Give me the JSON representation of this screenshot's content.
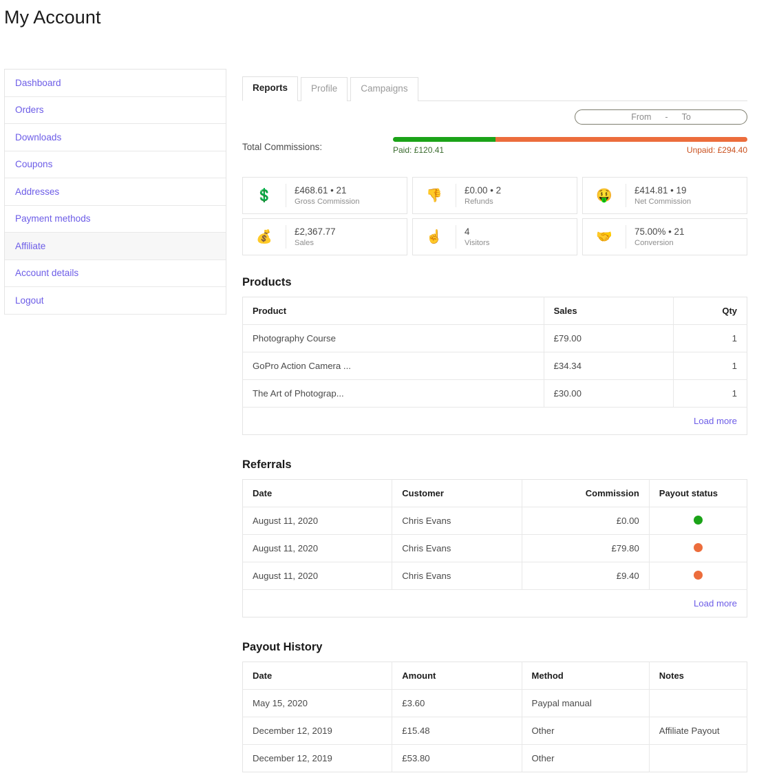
{
  "page": {
    "title": "My Account"
  },
  "sidebar": {
    "items": [
      {
        "label": "Dashboard",
        "active": false
      },
      {
        "label": "Orders",
        "active": false
      },
      {
        "label": "Downloads",
        "active": false
      },
      {
        "label": "Coupons",
        "active": false
      },
      {
        "label": "Addresses",
        "active": false
      },
      {
        "label": "Payment methods",
        "active": false
      },
      {
        "label": "Affiliate",
        "active": true
      },
      {
        "label": "Account details",
        "active": false
      },
      {
        "label": "Logout",
        "active": false
      }
    ]
  },
  "tabs": [
    {
      "label": "Reports",
      "active": true
    },
    {
      "label": "Profile",
      "active": false
    },
    {
      "label": "Campaigns",
      "active": false
    }
  ],
  "date_filter": {
    "from_placeholder": "From",
    "separator": "-",
    "to_placeholder": "To"
  },
  "commissions": {
    "label": "Total Commissions:",
    "paid_legend": "Paid: £120.41",
    "unpaid_legend": "Unpaid: £294.40",
    "paid_amount": 120.41,
    "unpaid_amount": 294.4,
    "paid_percent": 29,
    "paid_color": "#1ba318",
    "unpaid_color": "#ec6d3c"
  },
  "stats": [
    {
      "icon": "dollar-sign-icon",
      "glyph": "💲",
      "value": "£468.61 • 21",
      "label": "Gross Commission"
    },
    {
      "icon": "thumbs-down-icon",
      "glyph": "👎",
      "value": "£0.00 • 2",
      "label": "Refunds"
    },
    {
      "icon": "money-with-wings-icon",
      "glyph": "🤑",
      "value": "£414.81 • 19",
      "label": "Net Commission"
    },
    {
      "icon": "coins-icon",
      "glyph": "💰",
      "value": "£2,367.77",
      "label": "Sales"
    },
    {
      "icon": "pointing-finger-icon",
      "glyph": "☝",
      "value": "4",
      "label": "Visitors"
    },
    {
      "icon": "handshake-icon",
      "glyph": "🤝",
      "value": "75.00% • 21",
      "label": "Conversion"
    }
  ],
  "products": {
    "title": "Products",
    "columns": [
      "Product",
      "Sales",
      "Qty"
    ],
    "rows": [
      {
        "product": "Photography Course",
        "sales": "£79.00",
        "qty": "1"
      },
      {
        "product": "GoPro Action Camera ...",
        "sales": "£34.34",
        "qty": "1"
      },
      {
        "product": "The Art of Photograp...",
        "sales": "£30.00",
        "qty": "1"
      }
    ],
    "load_more": "Load more"
  },
  "referrals": {
    "title": "Referrals",
    "columns": [
      "Date",
      "Customer",
      "Commission",
      "Payout status"
    ],
    "rows": [
      {
        "date": "August 11, 2020",
        "customer": "Chris Evans",
        "commission": "£0.00",
        "status_color": "#1ba318"
      },
      {
        "date": "August 11, 2020",
        "customer": "Chris Evans",
        "commission": "£79.80",
        "status_color": "#ec6d3c"
      },
      {
        "date": "August 11, 2020",
        "customer": "Chris Evans",
        "commission": "£9.40",
        "status_color": "#ec6d3c"
      }
    ],
    "load_more": "Load more"
  },
  "payout_history": {
    "title": "Payout History",
    "columns": [
      "Date",
      "Amount",
      "Method",
      "Notes"
    ],
    "rows": [
      {
        "date": "May 15, 2020",
        "amount": "£3.60",
        "method": "Paypal manual",
        "notes": ""
      },
      {
        "date": "December 12, 2019",
        "amount": "£15.48",
        "method": "Other",
        "notes": "Affiliate Payout"
      },
      {
        "date": "December 12, 2019",
        "amount": "£53.80",
        "method": "Other",
        "notes": ""
      }
    ]
  }
}
